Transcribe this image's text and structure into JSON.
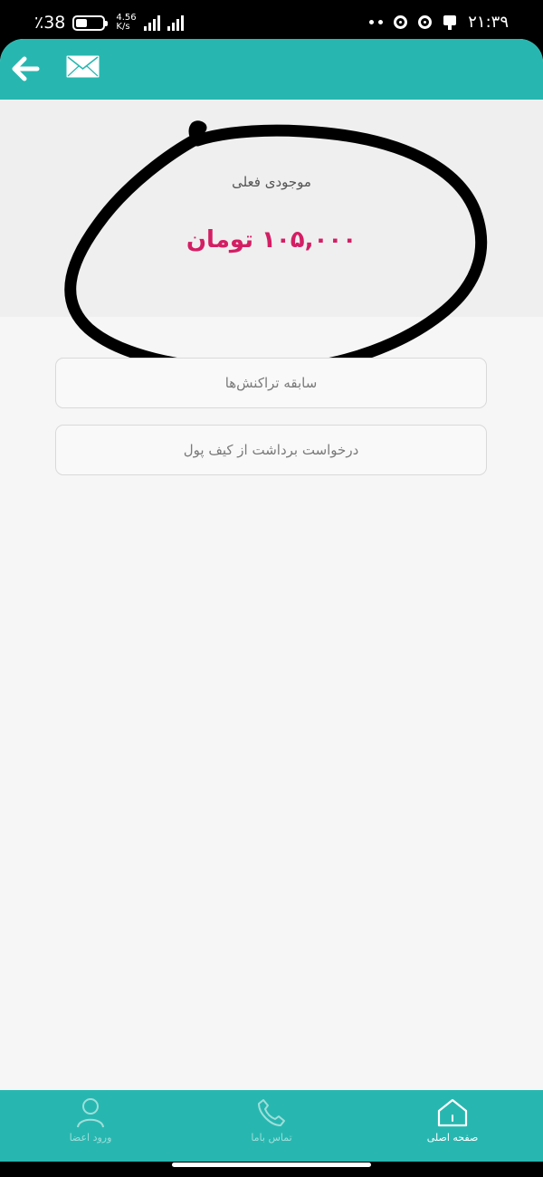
{
  "status_bar": {
    "battery_text": "٪38",
    "network_speed": "4.56",
    "network_unit": "K/s",
    "time": "۲۱:۳۹"
  },
  "toolbar": {
    "back_icon": "arrow-left-icon",
    "mail_icon": "envelope-icon",
    "color": "#27b7b0"
  },
  "balance": {
    "label": "موجودی فعلی",
    "amount": "۱۰۵,۰۰۰ تومان",
    "amount_color": "#d41e64"
  },
  "actions": {
    "history_label": "سابقه تراکنش‌ها",
    "withdraw_label": "درخواست برداشت از کیف پول"
  },
  "bottom_nav": {
    "home_label": "صفحه اصلی",
    "contact_label": "تماس باما",
    "login_label": "ورود اعضا"
  }
}
